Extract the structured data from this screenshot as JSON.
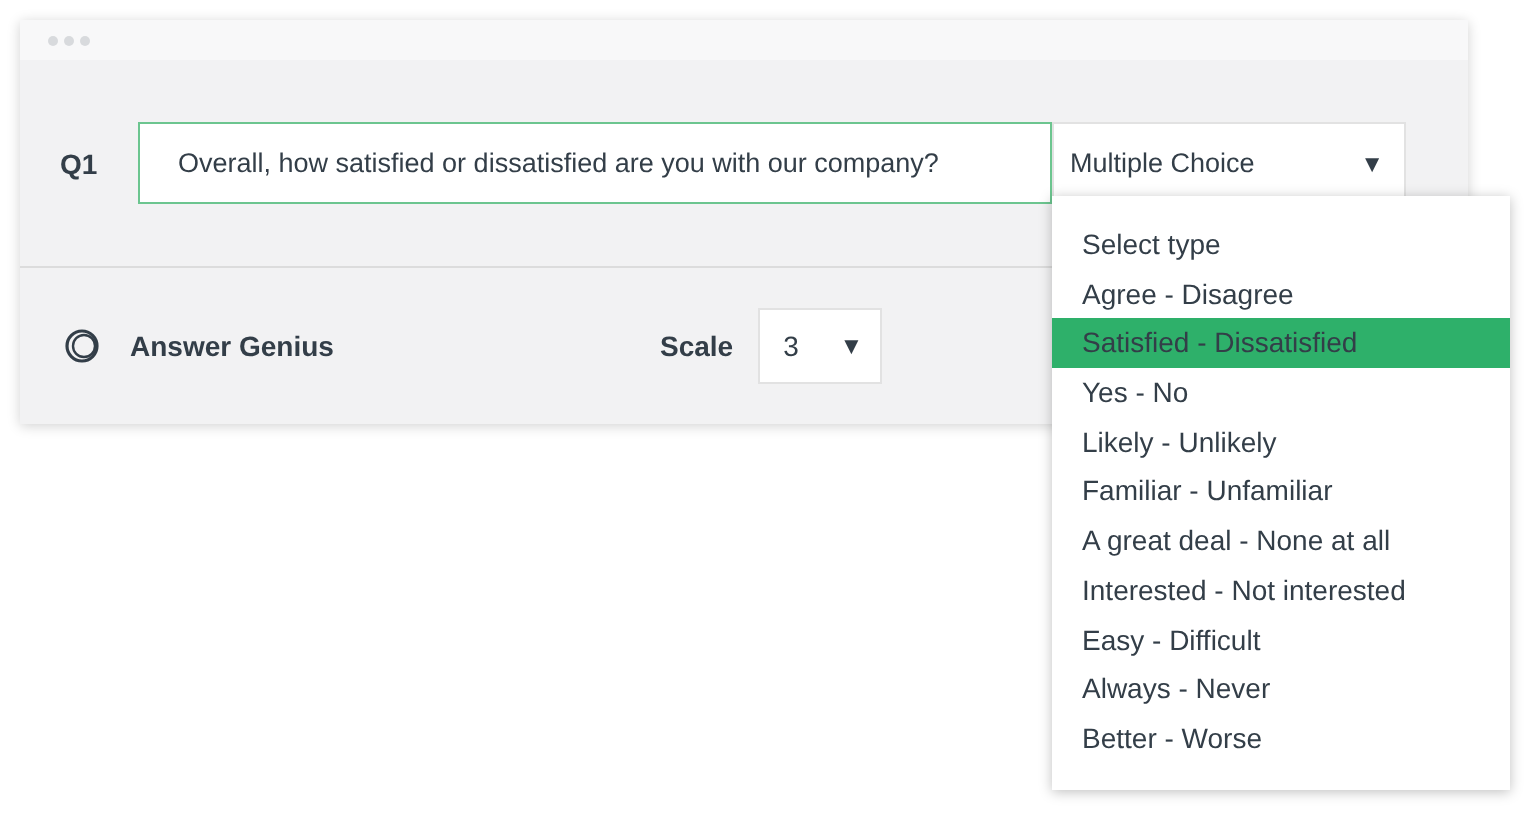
{
  "question": {
    "number": "Q1",
    "text": "Overall, how satisfied or dissatisfied are you with our company?",
    "type_select": {
      "value": "Multiple Choice",
      "arrow": "▼"
    }
  },
  "footer": {
    "feature": "Answer Genius",
    "scale_label": "Scale",
    "scale_select": {
      "value": "3",
      "arrow": "▼"
    }
  },
  "type_menu": {
    "header": "Select type",
    "items": [
      {
        "label": "Agree - Disagree",
        "selected": false
      },
      {
        "label": "Satisfied - Dissatisfied",
        "selected": true
      },
      {
        "label": "Yes - No",
        "selected": false
      },
      {
        "label": "Likely - Unlikely",
        "selected": false
      },
      {
        "label": "Familiar - Unfamiliar",
        "selected": false
      },
      {
        "label": "A great deal - None at all",
        "selected": false
      },
      {
        "label": "Interested - Not interested",
        "selected": false
      },
      {
        "label": "Easy - Difficult",
        "selected": false
      },
      {
        "label": "Always - Never",
        "selected": false
      },
      {
        "label": "Better - Worse",
        "selected": false
      }
    ]
  }
}
